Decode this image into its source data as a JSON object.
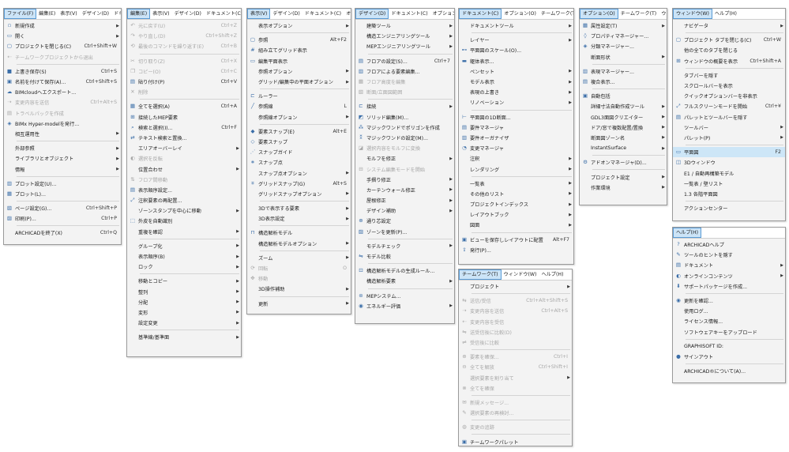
{
  "menus": [
    {
      "id": "file",
      "menubar": [
        "ファイル(F)",
        "編集(E)",
        "表示(V)",
        "デザイン(D)",
        "ドキ"
      ],
      "active": 0,
      "items": [
        {
          "label": "新規作成",
          "arrow": true,
          "icon": "new-doc-icon"
        },
        {
          "label": "開く",
          "arrow": true,
          "icon": "open-folder-icon"
        },
        {
          "label": "プロジェクトを閉じる(C)",
          "shortcut": "Ctrl+Shift+W",
          "icon": "close-project-icon"
        },
        {
          "label": "チームワークプロジェクトから退出",
          "disabled": true,
          "icon": "teamwork-leave-icon"
        },
        {
          "sep": true
        },
        {
          "label": "上書き保存(S)",
          "shortcut": "Ctrl+S",
          "icon": "save-icon"
        },
        {
          "label": "名前を付けて保存(A)...",
          "shortcut": "Ctrl+Shift+S",
          "icon": "save-as-icon"
        },
        {
          "label": "BIMcloudへエクスポート...",
          "icon": "bimcloud-export-icon"
        },
        {
          "label": "変更内容を送信",
          "shortcut": "Ctrl+Alt+S",
          "disabled": true,
          "icon": "send-changes-icon"
        },
        {
          "label": "トラベルパックを作成",
          "disabled": true,
          "icon": "travel-pack-icon"
        },
        {
          "label": "BIMx Hyper-modelを発行...",
          "icon": "bimx-icon"
        },
        {
          "label": "相互運用性",
          "arrow": true
        },
        {
          "sep": true
        },
        {
          "label": "外部参照",
          "arrow": true
        },
        {
          "label": "ライブラリとオブジェクト",
          "arrow": true
        },
        {
          "label": "情報",
          "arrow": true
        },
        {
          "sep": true
        },
        {
          "label": "プロット設定(U)...",
          "icon": "plot-setup-icon"
        },
        {
          "label": "プロット(L)...",
          "icon": "plot-icon"
        },
        {
          "sep": true
        },
        {
          "label": "ページ設定(G)...",
          "shortcut": "Ctrl+Shift+P",
          "icon": "page-setup-icon"
        },
        {
          "label": "印刷(P)...",
          "shortcut": "Ctrl+P",
          "icon": "print-icon"
        },
        {
          "sep": true
        },
        {
          "label": "ARCHICADを終了(X)",
          "shortcut": "Ctrl+Q"
        }
      ]
    },
    {
      "id": "edit",
      "menubar": [
        "編集(E)",
        "表示(V)",
        "デザイン(D)",
        "ドキュメント(C)"
      ],
      "active": 0,
      "items": [
        {
          "label": "元に戻す(U)",
          "shortcut": "Ctrl+Z",
          "disabled": true,
          "icon": "undo-icon"
        },
        {
          "label": "やり直し(D)",
          "shortcut": "Ctrl+Shift+Z",
          "disabled": true,
          "icon": "redo-icon"
        },
        {
          "label": "最後のコマンドを繰り返す(E)",
          "shortcut": "Ctrl+B",
          "disabled": true,
          "icon": "repeat-icon"
        },
        {
          "sep": true
        },
        {
          "label": "切り取り(Z)",
          "shortcut": "Ctrl+X",
          "disabled": true,
          "icon": "cut-icon"
        },
        {
          "label": "コピー(O)",
          "shortcut": "Ctrl+C",
          "disabled": true,
          "icon": "copy-icon"
        },
        {
          "label": "貼り付け(P)",
          "shortcut": "Ctrl+V",
          "icon": "paste-icon"
        },
        {
          "label": "削除",
          "disabled": true,
          "icon": "delete-icon"
        },
        {
          "sep": true
        },
        {
          "label": "全てを選択(A)",
          "shortcut": "Ctrl+A",
          "icon": "select-all-icon"
        },
        {
          "label": "接続したMEP要素",
          "icon": "mep-connected-icon"
        },
        {
          "label": "検索と選択(I)...",
          "shortcut": "Ctrl+F",
          "icon": "find-select-icon"
        },
        {
          "label": "テキスト検索と置換...",
          "icon": "find-replace-icon"
        },
        {
          "label": "エリアオーバーレイ",
          "arrow": true
        },
        {
          "label": "選択を反転",
          "disabled": true,
          "icon": "invert-select-icon"
        },
        {
          "label": "位置合わせ",
          "arrow": true
        },
        {
          "label": "フロア間移動",
          "disabled": true,
          "icon": "floor-move-icon"
        },
        {
          "label": "表示順序設定...",
          "icon": "display-order-icon"
        },
        {
          "label": "注釈要素の再配置...",
          "icon": "reposition-icon"
        },
        {
          "label": "ゾーンスタンプを中心に移動",
          "arrow": true
        },
        {
          "label": "外皮を自動識別",
          "icon": "envelope-icon"
        },
        {
          "label": "重複を確認",
          "arrow": true
        },
        {
          "sep": true
        },
        {
          "label": "グループ化",
          "arrow": true
        },
        {
          "label": "表示順序(B)",
          "arrow": true
        },
        {
          "label": "ロック",
          "arrow": true
        },
        {
          "sep": true
        },
        {
          "label": "移動とコピー",
          "arrow": true
        },
        {
          "label": "整列",
          "arrow": true
        },
        {
          "label": "分配",
          "arrow": true
        },
        {
          "label": "変形",
          "arrow": true
        },
        {
          "label": "設定変更",
          "arrow": true
        },
        {
          "sep": true
        },
        {
          "label": "基準線/基準面",
          "arrow": true
        }
      ]
    },
    {
      "id": "view",
      "menubar": [
        "表示(V)",
        "デザイン(D)",
        "ドキュメント(C)",
        "オプ"
      ],
      "active": 0,
      "items": [
        {
          "label": "表示オプション",
          "arrow": true
        },
        {
          "sep": true
        },
        {
          "label": "参照",
          "shortcut": "Alt+F2",
          "icon": "reference-icon"
        },
        {
          "label": "組み立てグリッド表示",
          "icon": "grid-icon"
        },
        {
          "label": "編集平面表示",
          "icon": "edit-plane-icon"
        },
        {
          "label": "参照オプション",
          "arrow": true
        },
        {
          "label": "グリッド/編集中の平面オプション",
          "arrow": true
        },
        {
          "sep": true
        },
        {
          "label": "ルーラー",
          "icon": "ruler-icon"
        },
        {
          "label": "参照線",
          "shortcut": "L",
          "icon": "guide-line-icon"
        },
        {
          "label": "参照線オプション",
          "arrow": true
        },
        {
          "sep": true
        },
        {
          "label": "要素スナップ(E)",
          "shortcut": "Alt+E",
          "icon": "element-snap-icon"
        },
        {
          "label": "要素スナップ",
          "icon": "snap-icon"
        },
        {
          "label": "スナップガイド",
          "icon": "snap-guide-icon"
        },
        {
          "label": "スナップ点",
          "icon": "snap-point-icon"
        },
        {
          "label": "スナップ点オプション",
          "arrow": true
        },
        {
          "label": "グリッドスナップ(G)",
          "shortcut": "Alt+S",
          "icon": "grid-snap-icon"
        },
        {
          "label": "グリッドスナップオプション",
          "arrow": true
        },
        {
          "sep": true
        },
        {
          "label": "3Dで表示する要素",
          "arrow": true
        },
        {
          "label": "3D表示設定",
          "arrow": true
        },
        {
          "sep": true
        },
        {
          "label": "構造解析モデル",
          "icon": "structural-model-icon"
        },
        {
          "label": "構造解析モデルオプション",
          "arrow": true
        },
        {
          "sep": true
        },
        {
          "label": "ズーム",
          "arrow": true
        },
        {
          "label": "回転",
          "shortcut": "O",
          "disabled": true,
          "icon": "rotate-icon"
        },
        {
          "label": "移動",
          "disabled": true,
          "icon": "pan-icon"
        },
        {
          "label": "3D操作補助",
          "arrow": true
        },
        {
          "sep": true
        },
        {
          "label": "更新",
          "arrow": true
        }
      ]
    },
    {
      "id": "design",
      "menubar": [
        "デザイン(D)",
        "ドキュメント(C)",
        "オプション(O)"
      ],
      "active": 0,
      "items": [
        {
          "label": "建築ツール",
          "arrow": true
        },
        {
          "label": "構造エンジニアリングツール",
          "arrow": true
        },
        {
          "label": "MEPエンジニアリングツール",
          "arrow": true
        },
        {
          "sep": true
        },
        {
          "label": "フロアの設定(S)...",
          "shortcut": "Ctrl+7",
          "icon": "floor-settings-icon"
        },
        {
          "label": "フロアによる要素編集...",
          "icon": "floor-edit-icon"
        },
        {
          "label": "フロア高度を編集",
          "disabled": true,
          "icon": "floor-height-icon"
        },
        {
          "label": "断面/立面図範囲",
          "disabled": true,
          "icon": "section-range-icon"
        },
        {
          "sep": true
        },
        {
          "label": "接続",
          "arrow": true,
          "icon": "connect-icon"
        },
        {
          "label": "ソリッド編集(M)...",
          "icon": "solid-edit-icon"
        },
        {
          "label": "マジックワンドでポリゴンを作成",
          "icon": "magic-wand-icon"
        },
        {
          "label": "マジックワンドの設定(M)...",
          "icon": "magic-wand-settings-icon"
        },
        {
          "label": "選択内容をモルフに変換",
          "disabled": true,
          "icon": "convert-morph-icon"
        },
        {
          "label": "モルフを修正",
          "arrow": true
        },
        {
          "label": "システム編集モードを開始",
          "disabled": true,
          "icon": "system-edit-icon"
        },
        {
          "label": "手摺り修正",
          "arrow": true
        },
        {
          "label": "カーテンウォール修正",
          "arrow": true
        },
        {
          "label": "屋根修正",
          "arrow": true
        },
        {
          "label": "デザイン補助",
          "arrow": true
        },
        {
          "label": "通り芯設定",
          "icon": "grid-line-icon"
        },
        {
          "label": "ゾーンを更新(P)...",
          "icon": "zone-update-icon"
        },
        {
          "sep": true
        },
        {
          "label": "モデルチェック",
          "arrow": true
        },
        {
          "label": "モデル比較",
          "icon": "model-compare-icon"
        },
        {
          "sep": true
        },
        {
          "label": "構造解析モデルの生成ルール...",
          "icon": "structural-rules-icon"
        },
        {
          "label": "構造解析要素",
          "arrow": true
        },
        {
          "sep": true
        },
        {
          "label": "MEPシステム...",
          "icon": "mep-system-icon"
        },
        {
          "label": "エネルギー評価",
          "arrow": true,
          "icon": "energy-icon"
        }
      ]
    },
    {
      "id": "document",
      "menubar": [
        "ドキュメント(C)",
        "オプション(O)",
        "チームワーク(T)",
        "ウ"
      ],
      "active": 0,
      "items": [
        {
          "label": "ドキュメントツール",
          "arrow": true
        },
        {
          "sep": true
        },
        {
          "label": "レイヤー",
          "arrow": true
        },
        {
          "label": "平面図のスケール(O)...",
          "icon": "scale-icon"
        },
        {
          "label": "躯体表示...",
          "icon": "structure-display-icon"
        },
        {
          "label": "ペンセット",
          "arrow": true
        },
        {
          "label": "モデル表示",
          "arrow": true
        },
        {
          "label": "表現の上書き",
          "arrow": true
        },
        {
          "label": "リノベーション",
          "arrow": true
        },
        {
          "sep": true
        },
        {
          "label": "平面図の1D断面...",
          "icon": "1d-section-icon"
        },
        {
          "label": "要件マネージャ",
          "icon": "requirements-icon"
        },
        {
          "label": "要件オーガナイザ",
          "icon": "organizer-icon"
        },
        {
          "label": "変更マネージャ",
          "icon": "change-manager-icon"
        },
        {
          "label": "注釈",
          "arrow": true
        },
        {
          "label": "レンダリング",
          "arrow": true
        },
        {
          "sep": true
        },
        {
          "label": "一覧表",
          "arrow": true
        },
        {
          "label": "その他のリスト",
          "arrow": true
        },
        {
          "label": "プロジェクトインデックス",
          "arrow": true
        },
        {
          "label": "レイアウトブック",
          "arrow": true
        },
        {
          "label": "図面",
          "arrow": true
        },
        {
          "sep": true
        },
        {
          "label": "ビューを保存しレイアウトに配置",
          "shortcut": "Alt+F7",
          "icon": "save-view-icon"
        },
        {
          "label": "発行(P)...",
          "icon": "publish-icon"
        }
      ]
    },
    {
      "id": "teamwork",
      "menubar": [
        "チームワーク(T)",
        "ウィンドウ(W)",
        "ヘルプ(H)"
      ],
      "active": 0,
      "items": [
        {
          "label": "プロジェクト",
          "arrow": true
        },
        {
          "sep": true
        },
        {
          "label": "送信/受信",
          "shortcut": "Ctrl+Alt+Shift+S",
          "disabled": true,
          "icon": "send-receive-icon"
        },
        {
          "label": "変更内容を送信",
          "shortcut": "Ctrl+Alt+S",
          "disabled": true,
          "icon": "send-icon"
        },
        {
          "label": "変更内容を受信",
          "disabled": true,
          "icon": "receive-icon"
        },
        {
          "label": "送受信後に比較(D)",
          "disabled": true,
          "icon": "compare-icon"
        },
        {
          "label": "受信後に比較",
          "disabled": true,
          "icon": "compare-after-icon"
        },
        {
          "sep": true
        },
        {
          "label": "要素を確保...",
          "shortcut": "Ctrl+I",
          "disabled": true,
          "icon": "reserve-icon"
        },
        {
          "label": "全てを解放",
          "shortcut": "Ctrl+Shift+I",
          "disabled": true,
          "icon": "release-icon"
        },
        {
          "label": "選択要素を割り当て",
          "arrow": true,
          "disabled": true
        },
        {
          "label": "全てを確保",
          "disabled": true,
          "icon": "reserve-all-icon"
        },
        {
          "sep": true
        },
        {
          "label": "新規メッセージ...",
          "disabled": true,
          "icon": "message-icon"
        },
        {
          "label": "選択要素の再検討...",
          "disabled": true,
          "icon": "review-icon"
        },
        {
          "sep": true
        },
        {
          "label": "変更の追跡",
          "disabled": true,
          "icon": "track-changes-icon"
        },
        {
          "sep": true
        },
        {
          "label": "チームワークパレット",
          "icon": "teamwork-palette-icon"
        }
      ]
    },
    {
      "id": "options",
      "menubar": [
        "オプション(O)",
        "チームワーク(T)",
        "ウィンド"
      ],
      "active": 0,
      "items": [
        {
          "label": "属性設定(T)",
          "arrow": true,
          "icon": "attributes-icon"
        },
        {
          "label": "プロパティマネージャー...",
          "icon": "property-manager-icon"
        },
        {
          "label": "分類マネージャー...",
          "icon": "classification-icon"
        },
        {
          "label": "断面形状",
          "arrow": true
        },
        {
          "sep": true
        },
        {
          "label": "表現マネージャー...",
          "icon": "display-manager-icon"
        },
        {
          "label": "複合表示...",
          "icon": "complex-display-icon"
        },
        {
          "sep": true
        },
        {
          "label": "自動包括",
          "icon": "auto-include-icon"
        },
        {
          "label": "詳細寸法自動作成ツール",
          "arrow": true
        },
        {
          "label": "GDL3面図クリエイター",
          "arrow": true
        },
        {
          "label": "ドア/窓で複数配置/置換",
          "arrow": true
        },
        {
          "label": "断面図ゾーン名",
          "arrow": true
        },
        {
          "label": "InstantSurface",
          "arrow": true
        },
        {
          "sep": true
        },
        {
          "label": "アドオンマネージャ(D)...",
          "icon": "addon-manager-icon"
        },
        {
          "sep": true
        },
        {
          "label": "プロジェクト設定",
          "arrow": true
        },
        {
          "label": "作業環境",
          "arrow": true
        }
      ]
    },
    {
      "id": "window",
      "menubar": [
        "ウィンドウ(W)",
        "ヘルプ(H)"
      ],
      "active": 0,
      "items": [
        {
          "label": "ナビゲータ",
          "arrow": true
        },
        {
          "sep": true
        },
        {
          "label": "プロジェクト タブを閉じる(C)",
          "shortcut": "Ctrl+W",
          "icon": "close-tab-icon"
        },
        {
          "label": "他の全てのタブを閉じる"
        },
        {
          "label": "ウィンドウの概要を表示",
          "shortcut": "Ctrl+Shift+A",
          "icon": "overview-icon"
        },
        {
          "sep": true
        },
        {
          "label": "タブバーを隠す"
        },
        {
          "label": "スクロールバーを表示"
        },
        {
          "label": "クイックオプションバーを非表示"
        },
        {
          "label": "フルスクリーンモードを開始",
          "shortcut": "Ctrl+¥",
          "icon": "fullscreen-icon"
        },
        {
          "label": "パレットとツールバーを隠す",
          "icon": "hide-palettes-icon"
        },
        {
          "label": "ツールバー",
          "arrow": true
        },
        {
          "label": "パレット(P)",
          "arrow": true
        },
        {
          "sep": true
        },
        {
          "label": "平面図",
          "shortcut": "F2",
          "highlight": true,
          "icon": "floor-plan-icon"
        },
        {
          "label": "3Dウィンドウ",
          "icon": "3d-window-icon"
        },
        {
          "label": "E1 / 自動再構築モデル"
        },
        {
          "label": "一覧表 / 壁リスト"
        },
        {
          "label": "1.3 各階平面図"
        },
        {
          "sep": true
        },
        {
          "label": "アクションセンター"
        }
      ]
    },
    {
      "id": "help",
      "menubar": [
        "ヘルプ(H)"
      ],
      "active": 0,
      "items": [
        {
          "label": "ARCHICADヘルプ",
          "icon": "help-icon"
        },
        {
          "label": "ツールのヒントを隠す",
          "icon": "tooltip-icon"
        },
        {
          "label": "ドキュメント",
          "arrow": true,
          "icon": "document-icon"
        },
        {
          "label": "オンラインコンテンツ",
          "arrow": true,
          "icon": "online-content-icon"
        },
        {
          "label": "サポートパッケージを作成...",
          "icon": "support-package-icon"
        },
        {
          "sep": true
        },
        {
          "label": "更新を確認...",
          "icon": "check-update-icon"
        },
        {
          "label": "使用ログ..."
        },
        {
          "label": "ライセンス情報..."
        },
        {
          "label": "ソフトウェアキーをアップロード"
        },
        {
          "sep": true
        },
        {
          "label": "GRAPHISOFT ID: "
        },
        {
          "label": "サインアウト",
          "icon": "user-icon"
        },
        {
          "sep": true
        },
        {
          "label": "ARCHICAD®について(A)..."
        }
      ]
    }
  ]
}
